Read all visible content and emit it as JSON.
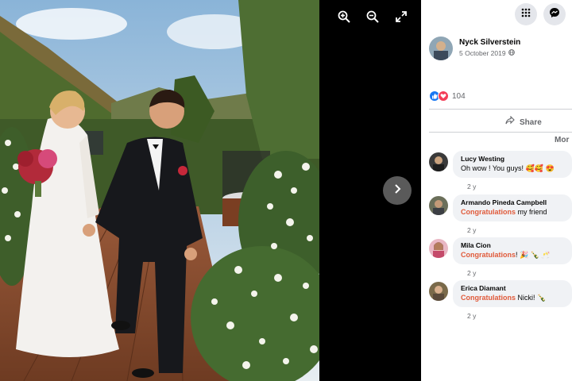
{
  "viewer": {
    "tools": [
      {
        "icon": "zoom-in-icon"
      },
      {
        "icon": "zoom-out-icon"
      },
      {
        "icon": "fullscreen-icon"
      }
    ],
    "next_icon": "chevron-right-icon"
  },
  "topbar": {
    "menu_icon": "grid-menu-icon",
    "messenger_icon": "messenger-icon"
  },
  "post": {
    "author": "Nyck Silverstein",
    "date": "5 October 2019",
    "privacy_icon": "globe-icon",
    "reaction_count": "104",
    "share_label": "Share",
    "more_label": "Mor"
  },
  "comments": [
    {
      "name": "Lucy Westing",
      "tag": "",
      "text": "Oh wow ! You guys! 🥰🥰 😍",
      "time": "2 y"
    },
    {
      "name": "Armando Pineda Campbell",
      "tag": "Congratulations",
      "text": " my friend",
      "time": "2 y"
    },
    {
      "name": "Mila Cion",
      "tag": "Congratulations",
      "text": "! 🎉 🍾 🥂",
      "time": "2 y"
    },
    {
      "name": "Erica Diamant",
      "tag": "Congratulations",
      "text": " Nicki! 🍾",
      "time": "2 y"
    }
  ],
  "colors": {
    "like_blue": "#1877f2",
    "love_red": "#f33e58",
    "tag_orange": "#e05a3a"
  }
}
